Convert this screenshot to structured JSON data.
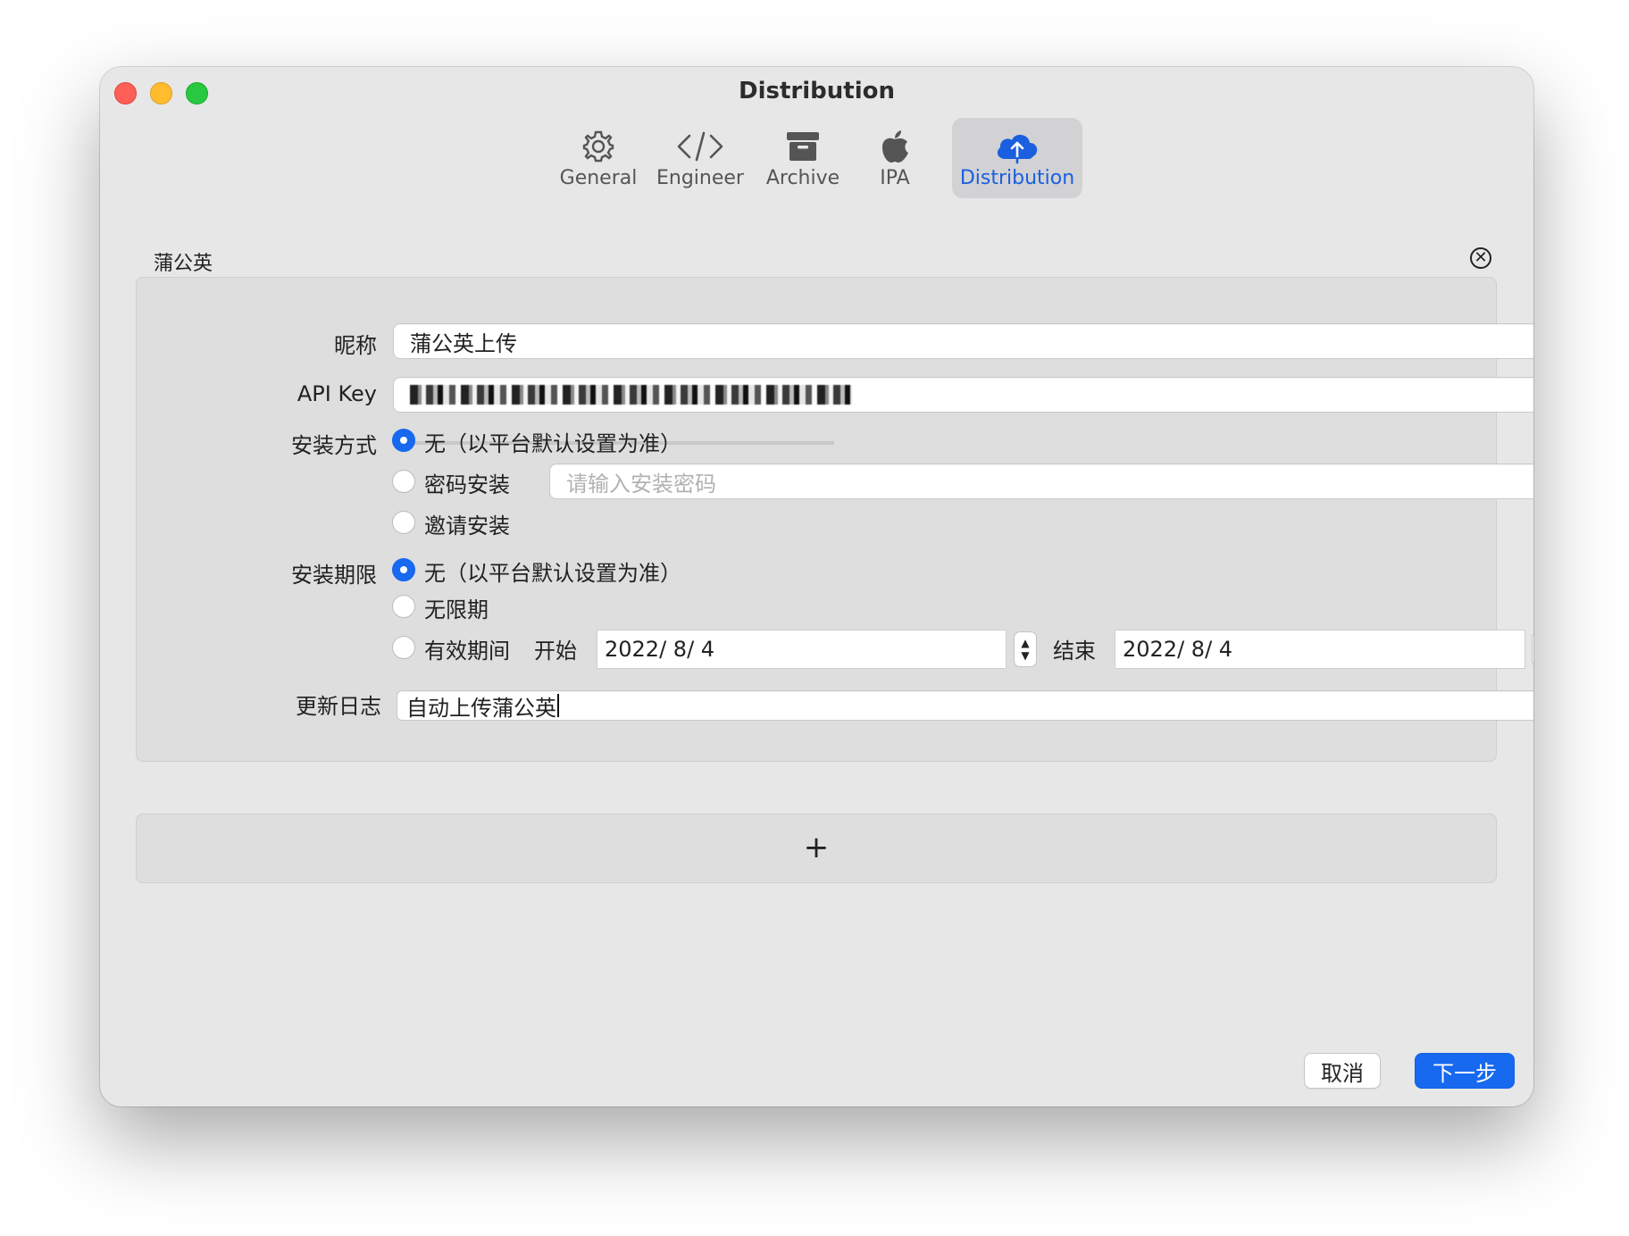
{
  "window": {
    "title": "Distribution"
  },
  "toolbar": {
    "tabs": [
      {
        "label": "General",
        "icon": "gear-icon"
      },
      {
        "label": "Engineer",
        "icon": "code-icon"
      },
      {
        "label": "Archive",
        "icon": "archive-box-icon"
      },
      {
        "label": "IPA",
        "icon": "apple-logo-icon"
      },
      {
        "label": "Distribution",
        "icon": "cloud-upload-icon",
        "active": true
      }
    ]
  },
  "section": {
    "title": "蒲公英",
    "fields": {
      "nickname_label": "昵称",
      "nickname_value": "蒲公英上传",
      "api_key_label": "API Key",
      "install_method_label": "安装方式",
      "install_methods": [
        {
          "label": "无（以平台默认设置为准）",
          "selected": true
        },
        {
          "label": "密码安装",
          "selected": false
        },
        {
          "label": "邀请安装",
          "selected": false
        }
      ],
      "password_placeholder": "请输入安装密码",
      "install_period_label": "安装期限",
      "install_periods": [
        {
          "label": "无（以平台默认设置为准）",
          "selected": true
        },
        {
          "label": "无限期",
          "selected": false
        },
        {
          "label": "有效期间",
          "selected": false
        }
      ],
      "start_label": "开始",
      "start_date": "2022/  8/  4",
      "end_label": "结束",
      "end_date": "2022/  8/  4",
      "changelog_label": "更新日志",
      "changelog_value": "自动上传蒲公英"
    }
  },
  "add_label": "+",
  "footer": {
    "cancel_label": "取消",
    "next_label": "下一步"
  },
  "colors": {
    "accent": "#1769f0",
    "window_bg": "#e7e7e7",
    "panel_bg": "#dedede"
  }
}
